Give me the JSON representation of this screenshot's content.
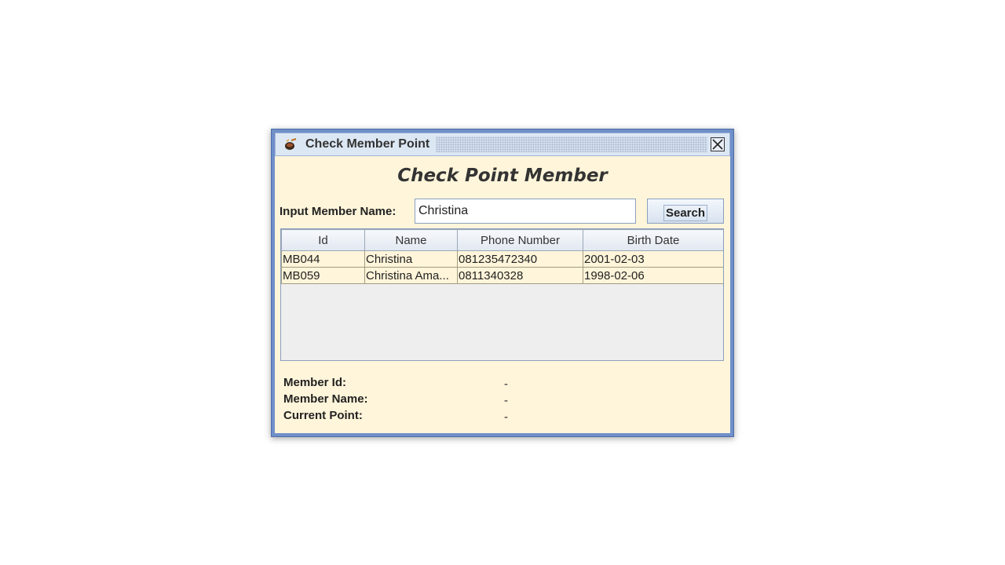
{
  "window": {
    "title": "Check Member Point",
    "app_icon": "coffee-icon",
    "close_icon": "close-icon"
  },
  "heading": "Check Point Member",
  "search": {
    "label": "Input Member Name:",
    "value": "Christina",
    "button_label": "Search"
  },
  "table": {
    "columns": [
      "Id",
      "Name",
      "Phone Number",
      "Birth Date"
    ],
    "rows": [
      [
        "MB044",
        "Christina",
        "081235472340",
        "2001-02-03"
      ],
      [
        "MB059",
        "Christina Ama...",
        "0811340328",
        "1998-02-06"
      ]
    ]
  },
  "details": {
    "member_id_label": "Member Id:",
    "member_id_value": "-",
    "member_name_label": "Member Name:",
    "member_name_value": "-",
    "current_point_label": "Current Point:",
    "current_point_value": "-"
  },
  "colors": {
    "frame": "#6f8fc9",
    "content_bg": "#fff5da",
    "table_bg": "#eeeeee"
  }
}
